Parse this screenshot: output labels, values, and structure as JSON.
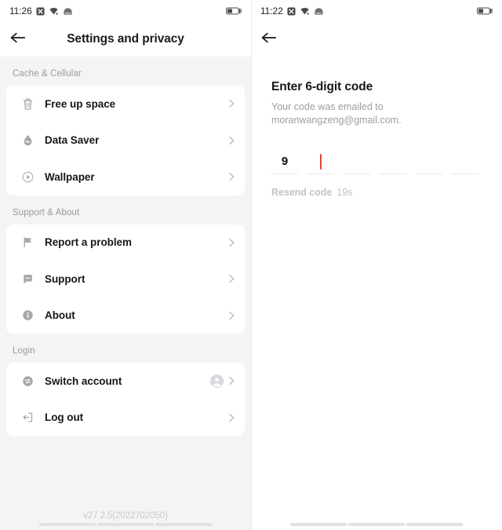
{
  "left_screen": {
    "status_bar": {
      "time": "11:26",
      "icons": [
        "no-sim-icon",
        "wifi-icon",
        "vpn-icon"
      ],
      "battery": "battery-charging-icon"
    },
    "header": {
      "back": "back-arrow-icon",
      "title": "Settings and privacy"
    },
    "sections": [
      {
        "label": "Cache & Cellular",
        "items": [
          {
            "icon": "trash-icon",
            "label": "Free up space",
            "chevron": true
          },
          {
            "icon": "data-saver-icon",
            "label": "Data Saver",
            "chevron": true
          },
          {
            "icon": "wallpaper-icon",
            "label": "Wallpaper",
            "chevron": true
          }
        ]
      },
      {
        "label": "Support & About",
        "items": [
          {
            "icon": "flag-icon",
            "label": "Report a problem",
            "chevron": true
          },
          {
            "icon": "chat-bubble-icon",
            "label": "Support",
            "chevron": true
          },
          {
            "icon": "info-icon",
            "label": "About",
            "chevron": true
          }
        ]
      },
      {
        "label": "Login",
        "items": [
          {
            "icon": "switch-account-icon",
            "label": "Switch account",
            "chevron": true,
            "avatar": true
          },
          {
            "icon": "logout-icon",
            "label": "Log out",
            "chevron": true
          }
        ]
      }
    ],
    "version": "v27.2.5(2022702050)"
  },
  "right_screen": {
    "status_bar": {
      "time": "11:22",
      "icons": [
        "no-sim-icon",
        "wifi-icon",
        "vpn-icon"
      ],
      "battery": "battery-charging-icon"
    },
    "header": {
      "back": "back-arrow-icon",
      "title": ""
    },
    "title": "Enter 6-digit code",
    "subtitle": "Your code was emailed to moranwangzeng@gmail.com.",
    "code_slots": [
      {
        "value": "9",
        "caret": false
      },
      {
        "value": "",
        "caret": true
      },
      {
        "value": "",
        "caret": false
      },
      {
        "value": "",
        "caret": false
      },
      {
        "value": "",
        "caret": false
      },
      {
        "value": "",
        "caret": false
      }
    ],
    "resend_label": "Resend code",
    "resend_timer": "19s",
    "caret_color": "#fb3a27"
  }
}
